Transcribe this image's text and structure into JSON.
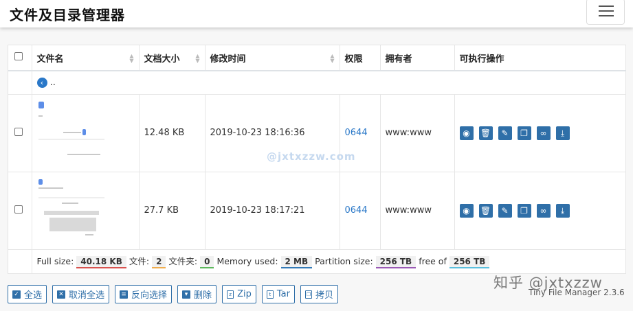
{
  "app": {
    "title": "文件及目录管理器"
  },
  "table": {
    "headers": [
      "文件名",
      "文档大小",
      "修改时间",
      "权限",
      "拥有者",
      "可执行操作"
    ],
    "parent_label": "..",
    "rows": [
      {
        "size": "12.48 KB",
        "modified": "2019-10-23 18:16:36",
        "perms": "0644",
        "owner": "www:www"
      },
      {
        "size": "27.7 KB",
        "modified": "2019-10-23 18:17:21",
        "perms": "0644",
        "owner": "www:www"
      }
    ],
    "actions": [
      {
        "icon": "eye-icon",
        "glyph": "◉"
      },
      {
        "icon": "trash-icon",
        "glyph": "🗑"
      },
      {
        "icon": "edit-icon",
        "glyph": "✎"
      },
      {
        "icon": "copy-icon",
        "glyph": "❐"
      },
      {
        "icon": "link-icon",
        "glyph": "∞"
      },
      {
        "icon": "download-icon",
        "glyph": "⤓"
      }
    ]
  },
  "footer": {
    "full_size_label": "Full size:",
    "full_size": "40.18 KB",
    "files_label": "文件:",
    "files": "2",
    "folders_label": "文件夹:",
    "folders": "0",
    "memory_label": "Memory used:",
    "memory": "2 MB",
    "partition_label": "Partition size:",
    "partition": "256 TB",
    "free_label": "free of",
    "free": "256 TB"
  },
  "buttons": {
    "select_all": "全选",
    "deselect_all": "取消全选",
    "invert": "反向选择",
    "delete": "删除",
    "zip": "Zip",
    "tar": "Tar",
    "copy": "拷贝"
  },
  "version": "Tiny File Manager 2.3.6",
  "watermarks": {
    "center": "@jxtxzzw.com",
    "corner": "知乎 @jxtxzzw"
  },
  "colors": {
    "accent": "#2f6fa8",
    "link": "#2a78c8"
  }
}
